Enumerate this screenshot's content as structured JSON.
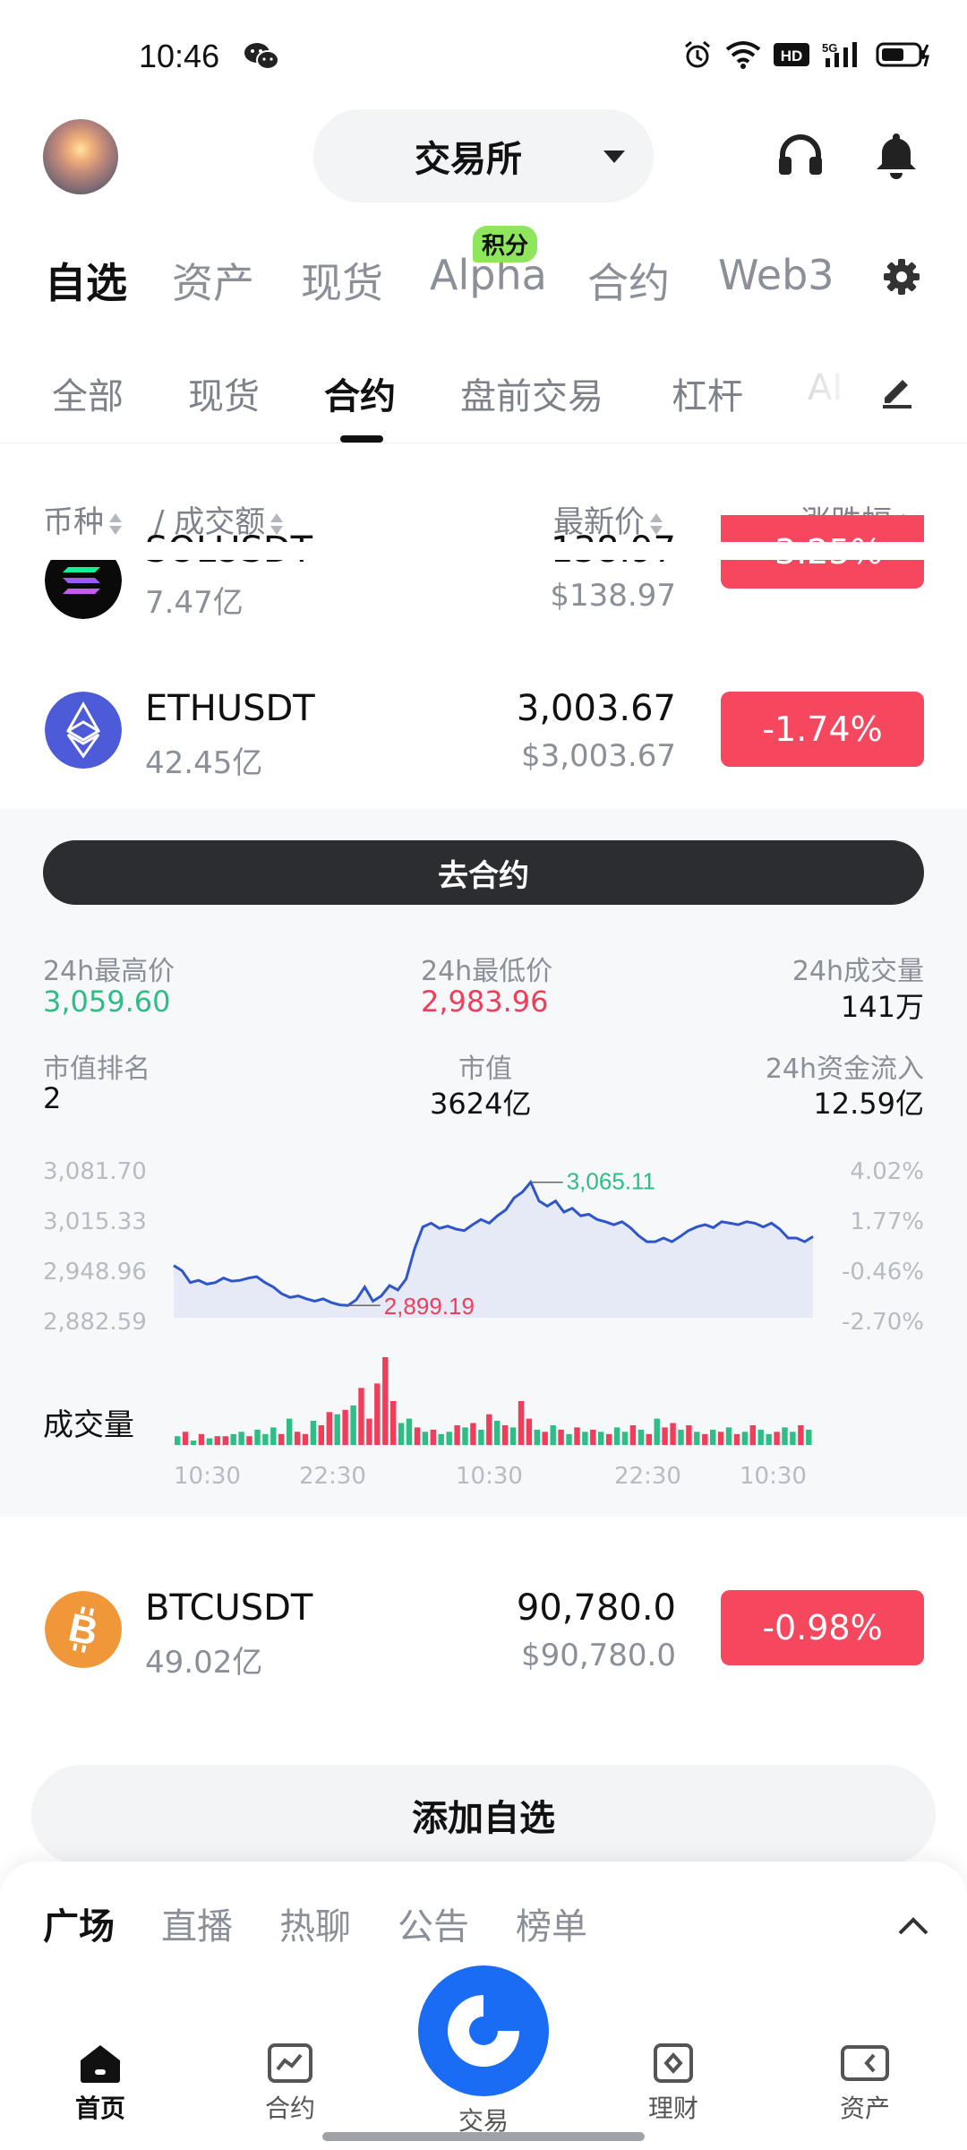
{
  "status_bar": {
    "time": "10:46"
  },
  "header": {
    "exchange_label": "交易所"
  },
  "top_tabs": [
    {
      "label": "自选",
      "active": true
    },
    {
      "label": "资产"
    },
    {
      "label": "现货"
    },
    {
      "label": "Alpha",
      "badge": "积分"
    },
    {
      "label": "合约"
    },
    {
      "label": "Web3"
    }
  ],
  "sub_tabs": [
    {
      "label": "全部"
    },
    {
      "label": "现货"
    },
    {
      "label": "合约",
      "active": true
    },
    {
      "label": "盘前交易"
    },
    {
      "label": "杠杆"
    },
    {
      "label": "AI"
    }
  ],
  "list_header": {
    "pair": "币种",
    "volume": "/ 成交额",
    "last_price": "最新价",
    "change": "涨跌幅"
  },
  "rows": [
    {
      "symbol": "SOLUSDT",
      "volume": "7.47亿",
      "price": "138.97",
      "usd": "$138.97",
      "change": "-3.25%"
    },
    {
      "symbol": "ETHUSDT",
      "volume": "42.45亿",
      "price": "3,003.67",
      "usd": "$3,003.67",
      "change": "-1.74%"
    },
    {
      "symbol": "BTCUSDT",
      "volume": "49.02亿",
      "price": "90,780.0",
      "usd": "$90,780.0",
      "change": "-0.98%"
    }
  ],
  "detail": {
    "go_button": "去合约",
    "stats": [
      {
        "label": "24h最高价",
        "value": "3,059.60"
      },
      {
        "label": "24h最低价",
        "value": "2,983.96"
      },
      {
        "label": "24h成交量",
        "value": "141万"
      },
      {
        "label": "市值排名",
        "value": "2"
      },
      {
        "label": "市值",
        "value": "3624亿"
      },
      {
        "label": "24h资金流入",
        "value": "12.59亿"
      }
    ],
    "volume_label": "成交量"
  },
  "chart_data": {
    "type": "line",
    "y_ticks_left": [
      "3,081.70",
      "3,015.33",
      "2,948.96",
      "2,882.59"
    ],
    "y_ticks_right": [
      "4.02%",
      "1.77%",
      "-0.46%",
      "-2.70%"
    ],
    "x_ticks": [
      "10:30",
      "22:30",
      "10:30",
      "22:30",
      "10:30"
    ],
    "ylim": [
      2882.59,
      3081.7
    ],
    "high_label": "3,065.11",
    "low_label": "2,899.19",
    "high": 3065.11,
    "low": 2899.19,
    "series": [
      {
        "values": [
          2953,
          2946,
          2930,
          2933,
          2928,
          2930,
          2936,
          2932,
          2933,
          2936,
          2938,
          2930,
          2924,
          2915,
          2910,
          2912,
          2908,
          2905,
          2908,
          2903,
          2900,
          2899.19,
          2907,
          2924,
          2905,
          2912,
          2926,
          2920,
          2935,
          2975,
          3005,
          3010,
          3003,
          3006,
          3002,
          3000,
          3008,
          3015,
          3010,
          3020,
          3028,
          3044,
          3052,
          3065.11,
          3040,
          3033,
          3040,
          3025,
          3030,
          3020,
          3022,
          3015,
          3012,
          3008,
          3012,
          3004,
          2993,
          2985,
          2985,
          2990,
          2985,
          2992,
          3000,
          3005,
          3008,
          3004,
          3012,
          3010,
          3008,
          3012,
          3010,
          3005,
          3010,
          3002,
          2990,
          2990,
          2985,
          2992
        ]
      }
    ],
    "volume": [
      4,
      6,
      2,
      5,
      3,
      4,
      4,
      5,
      6,
      4,
      7,
      5,
      8,
      5,
      12,
      6,
      5,
      11,
      9,
      15,
      14,
      16,
      18,
      26,
      12,
      28,
      40,
      20,
      10,
      12,
      8,
      6,
      7,
      5,
      6,
      9,
      8,
      10,
      7,
      14,
      11,
      9,
      8,
      20,
      12,
      7,
      6,
      9,
      7,
      5,
      8,
      6,
      7,
      6,
      5,
      8,
      6,
      9,
      7,
      5,
      12,
      8,
      10,
      7,
      9,
      6,
      5,
      7,
      6,
      8,
      5,
      6,
      9,
      7,
      5,
      6,
      8,
      6,
      9,
      7
    ],
    "volume_up": [
      1,
      0,
      1,
      0,
      1,
      0,
      0,
      1,
      1,
      0,
      1,
      1,
      1,
      0,
      1,
      0,
      0,
      1,
      0,
      0,
      1,
      0,
      1,
      0,
      0,
      0,
      0,
      0,
      1,
      1,
      0,
      1,
      0,
      1,
      1,
      0,
      1,
      0,
      1,
      0,
      1,
      0,
      1,
      0,
      0,
      1,
      0,
      1,
      0,
      1,
      0,
      1,
      0,
      1,
      0,
      1,
      1,
      0,
      1,
      0,
      1,
      0,
      0,
      1,
      0,
      1,
      0,
      1,
      0,
      1,
      0,
      1,
      0,
      1,
      1,
      0,
      1,
      1,
      0,
      1
    ]
  },
  "add_button": "添加自选",
  "feed_tabs": [
    {
      "label": "广场",
      "active": true
    },
    {
      "label": "直播"
    },
    {
      "label": "热聊"
    },
    {
      "label": "公告"
    },
    {
      "label": "榜单"
    }
  ],
  "bottom_nav": [
    {
      "label": "首页",
      "active": true
    },
    {
      "label": "合约"
    },
    {
      "label": "交易"
    },
    {
      "label": "理财"
    },
    {
      "label": "资产"
    }
  ]
}
